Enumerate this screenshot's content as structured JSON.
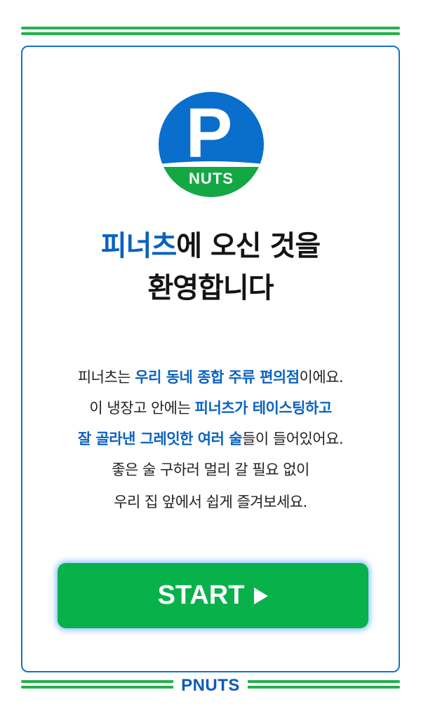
{
  "logo": {
    "letter": "P",
    "word": "NUTS"
  },
  "welcome": {
    "brand": "피너츠",
    "line1_rest": "에 오신 것을",
    "line2": "환영합니다"
  },
  "description": {
    "l1a": "피너츠는 ",
    "l1b": "우리 동네 종합 주류 편의점",
    "l1c": "이에요.",
    "l2a": "이 냉장고 안에는 ",
    "l2b": "피너츠가 테이스팅하고",
    "l3a": "잘 골라낸 그레잇한 여러 술",
    "l3b": "들이 들어있어요.",
    "l4": "좋은 술 구하러 멀리 갈 필요 없이",
    "l5": "우리 집 앞에서 쉽게 즐겨보세요."
  },
  "start_button": {
    "label": "START"
  },
  "footer": {
    "brand": "PNUTS"
  },
  "colors": {
    "green": "#08b14a",
    "blue": "#0a62c0",
    "border": "#1672c9"
  }
}
